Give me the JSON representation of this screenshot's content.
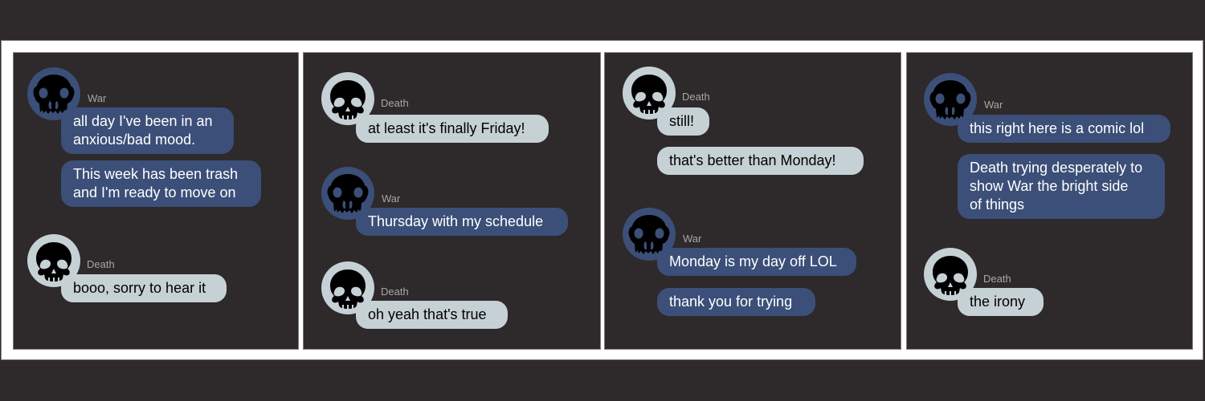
{
  "colors": {
    "background": "#2e292b",
    "frame": "#ffffff",
    "war_bubble": "#3b4f78",
    "death_bubble": "#c6d1d6",
    "sender_label": "#a7a7a7"
  },
  "characters": {
    "war": {
      "name": "War",
      "avatar_icon": "cat-skull-icon"
    },
    "death": {
      "name": "Death",
      "avatar_icon": "human-skull-icon"
    }
  },
  "panels": [
    {
      "messages": [
        {
          "sender": "War",
          "text": "all day I've been in an\nanxious/bad mood."
        },
        {
          "sender": "War",
          "text": "This week has been trash\nand I'm ready to move on"
        },
        {
          "sender": "Death",
          "text": "booo, sorry to hear it"
        }
      ]
    },
    {
      "messages": [
        {
          "sender": "Death",
          "text": "at least it's finally Friday!"
        },
        {
          "sender": "War",
          "text": "Thursday with my schedule"
        },
        {
          "sender": "Death",
          "text": "oh yeah that's true"
        }
      ]
    },
    {
      "messages": [
        {
          "sender": "Death",
          "text": "still!"
        },
        {
          "sender": "Death",
          "text": "that's better than Monday!"
        },
        {
          "sender": "War",
          "text": "Monday is my day off LOL"
        },
        {
          "sender": "War",
          "text": "thank you for trying"
        }
      ]
    },
    {
      "messages": [
        {
          "sender": "War",
          "text": "this right here is a comic lol"
        },
        {
          "sender": "War",
          "text": "Death trying desperately to\nshow War the bright side\nof things"
        },
        {
          "sender": "Death",
          "text": "the irony"
        }
      ]
    }
  ]
}
